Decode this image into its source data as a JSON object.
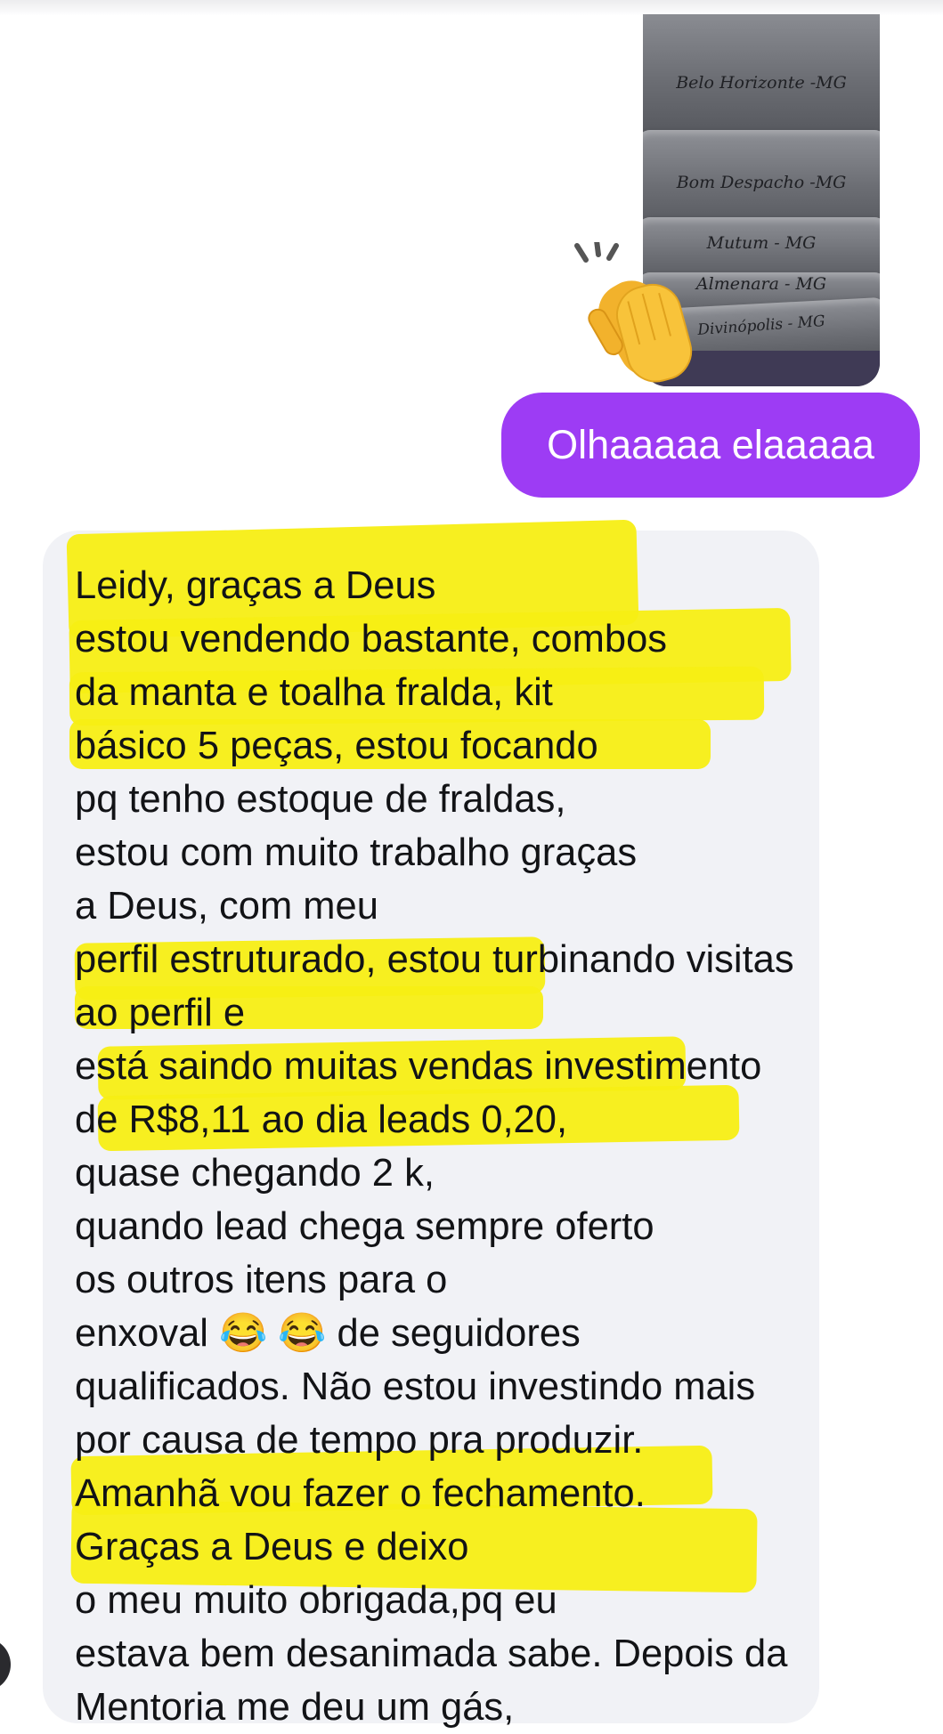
{
  "photo": {
    "labels": [
      "Belo Horizonte -MG",
      "Bom Despacho -MG",
      "Mutum - MG",
      "Almenara - MG",
      "Divinópolis - MG"
    ]
  },
  "reaction": {
    "emoji": "👏",
    "name": "clapping-hands"
  },
  "sent_message": {
    "text": "Olhaaaaa elaaaaa"
  },
  "received_message": {
    "text": "Leidy, graças a Deus estou vendendo bastante, combos da manta e toalha fralda, kit básico 5 peças, estou focando pq tenho estoque de fraldas, estou com muito trabalho graças a Deus, com meu perfil estruturado, estou turbinando visitas ao perfil e está saindo muitas vendas investimento de R$8,11 ao dia leads  0,20, quase chegando 2 k, quando lead chega sempre oferto os outros itens para o enxoval 😂 😂  de seguidores qualificados. Não estou investindo mais por causa de tempo pra produzir. Amanhã vou fazer o fechamento. Graças a Deus  e deixo o meu muito obrigada,pq eu estava bem desanimada sabe. Depois da Mentoria me deu um gás,"
  },
  "colors": {
    "sent_bubble": "#9d3cf4",
    "received_bubble": "#f1f2f6",
    "highlight": "#f7ee14"
  }
}
